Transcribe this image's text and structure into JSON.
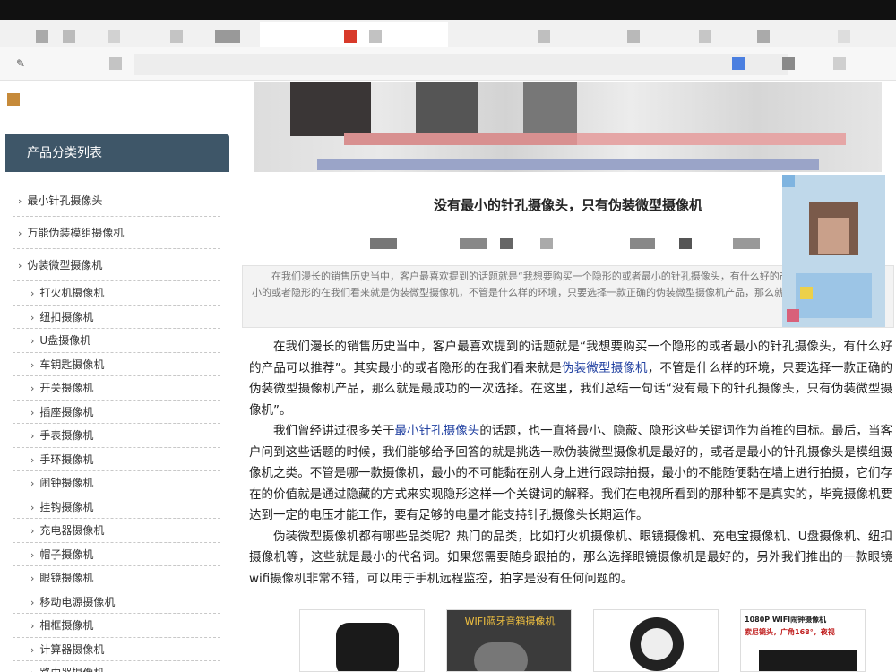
{
  "sidebar": {
    "title": "产品分类列表",
    "items": [
      {
        "label": "最小针孔摄像头",
        "level": "top"
      },
      {
        "label": "万能伪装模组摄像机",
        "level": "top"
      },
      {
        "label": "伪装微型摄像机",
        "level": "top"
      },
      {
        "label": "打火机摄像机",
        "level": "sub"
      },
      {
        "label": "纽扣摄像机",
        "level": "sub"
      },
      {
        "label": "U盘摄像机",
        "level": "sub"
      },
      {
        "label": "车钥匙摄像机",
        "level": "sub"
      },
      {
        "label": "开关摄像机",
        "level": "sub"
      },
      {
        "label": "插座摄像机",
        "level": "sub"
      },
      {
        "label": "手表摄像机",
        "level": "sub"
      },
      {
        "label": "手环摄像机",
        "level": "sub"
      },
      {
        "label": "闹钟摄像机",
        "level": "sub"
      },
      {
        "label": "挂钩摄像机",
        "level": "sub"
      },
      {
        "label": "充电器摄像机",
        "level": "sub"
      },
      {
        "label": "帽子摄像机",
        "level": "sub"
      },
      {
        "label": "眼镜摄像机",
        "level": "sub"
      },
      {
        "label": "移动电源摄像机",
        "level": "sub"
      },
      {
        "label": "相框摄像机",
        "level": "sub"
      },
      {
        "label": "计算器摄像机",
        "level": "sub"
      },
      {
        "label": "路由器摄像机",
        "level": "sub"
      }
    ]
  },
  "article": {
    "title_prefix": "没有最小的针孔摄像头，只有",
    "title_link": "伪装微型摄像机",
    "summary": "在我们漫长的销售历史当中，客户最喜欢提到的话题就是“我想要购买一个隐形的或者最小的针孔摄像头，有什么好的产品可以推荐”。其实最小的或者隐形的在我们看来就是伪装微型摄像机，不管是什么样的环境，只要选择一款正确的伪装微型摄像机产品，那么就是最成功的一次选择。",
    "p1_a": "在我们漫长的销售历史当中，客户最喜欢提到的话题就是“我想要购买一个隐形的或者最小的针孔摄像头，有什么好的产品可以推荐”。其实最小的或者隐形的在我们看来就是",
    "p1_link": "伪装微型摄像机",
    "p1_b": "，不管是什么样的环境，只要选择一款正确的伪装微型摄像机产品，那么就是最成功的一次选择。在这里，我们总结一句话“没有最下的针孔摄像头，只有伪装微型摄像机”。",
    "p2_a": "我们曾经讲过很多关于",
    "p2_link": "最小针孔摄像头",
    "p2_b": "的话题，也一直将最小、隐蔽、隐形这些关键词作为首推的目标。最后，当客户问到这些话题的时候，我们能够给予回答的就是挑选一款伪装微型摄像机是最好的，或者是最小的针孔摄像头是模组摄像机之类。不管是哪一款摄像机，最小的不可能黏在别人身上进行跟踪拍摄，最小的不能随便黏在墙上进行拍摄，它们存在的价值就是通过隐藏的方式来实现隐形这样一个关键词的解释。我们在电视所看到的那种都不是真实的，毕竟摄像机要达到一定的电压才能工作，要有足够的电量才能支持针孔摄像头长期运作。",
    "p3": "伪装微型摄像机都有哪些品类呢？热门的品类，比如打火机摄像机、眼镜摄像机、充电宝摄像机、U盘摄像机、纽扣摄像机等，这些就是最小的代名词。如果您需要随身跟拍的，那么选择眼镜摄像机是最好的，另外我们推出的一款眼镜wifi摄像机非常不错，可以用于手机远程监控，拍字是没有任何问题的。"
  },
  "products": [
    {
      "name": "car-key-camera"
    },
    {
      "name": "wifi-camera",
      "caption": "WIFI蓝牙音箱摄像机"
    },
    {
      "name": "round-camera"
    },
    {
      "name": "clock-camera",
      "caption": "1080P WIFI闹钟摄像机",
      "caption2": "索尼镜头，广角168°，夜视"
    }
  ],
  "colors": {
    "sidebar_header": "#3e5668",
    "link": "#1f3fa0"
  }
}
